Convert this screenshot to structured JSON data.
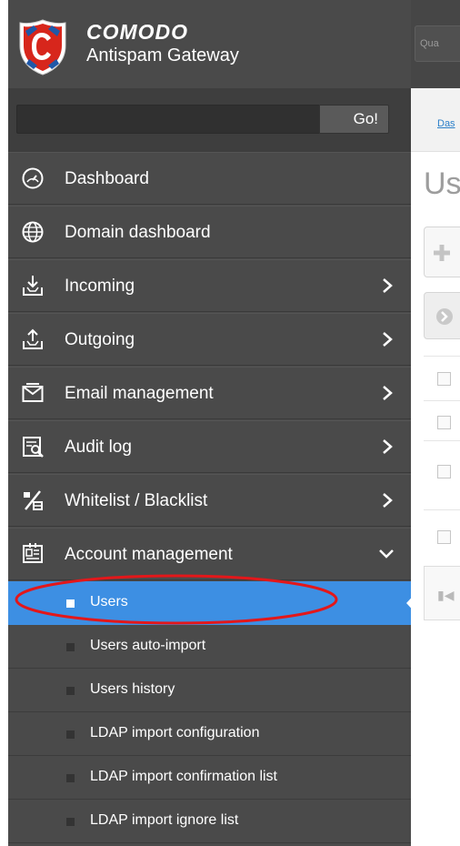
{
  "brand": {
    "name": "COMODO",
    "subtitle": "Antispam Gateway"
  },
  "search": {
    "placeholder": "",
    "value": "",
    "button_label": "Go!"
  },
  "menu": [
    {
      "label": "Dashboard",
      "icon": "dashboard-gauge-icon",
      "has_children": false
    },
    {
      "label": "Domain dashboard",
      "icon": "globe-icon",
      "has_children": false
    },
    {
      "label": "Incoming",
      "icon": "inbox-download-icon",
      "has_children": true
    },
    {
      "label": "Outgoing",
      "icon": "outbox-upload-icon",
      "has_children": true
    },
    {
      "label": "Email management",
      "icon": "envelope-icon",
      "has_children": true
    },
    {
      "label": "Audit log",
      "icon": "audit-log-icon",
      "has_children": true
    },
    {
      "label": "Whitelist / Blacklist",
      "icon": "whitelist-blacklist-icon",
      "has_children": true
    },
    {
      "label": "Account management",
      "icon": "account-management-icon",
      "has_children": true,
      "expanded": true
    }
  ],
  "submenu": [
    {
      "label": "Users",
      "active": true
    },
    {
      "label": "Users auto-import",
      "active": false
    },
    {
      "label": "Users history",
      "active": false
    },
    {
      "label": "LDAP import configuration",
      "active": false
    },
    {
      "label": "LDAP import confirmation list",
      "active": false
    },
    {
      "label": "LDAP import ignore list",
      "active": false
    }
  ],
  "content": {
    "quick_button_partial": "Qua",
    "breadcrumb_partial": "Das",
    "page_title_partial": "Us"
  },
  "colors": {
    "sidebar_bg": "#4a4a4a",
    "active_item": "#3d8fe3",
    "annotation_ellipse": "#e3171a",
    "logo_red": "#d7261c",
    "logo_blue": "#1f58a8"
  }
}
